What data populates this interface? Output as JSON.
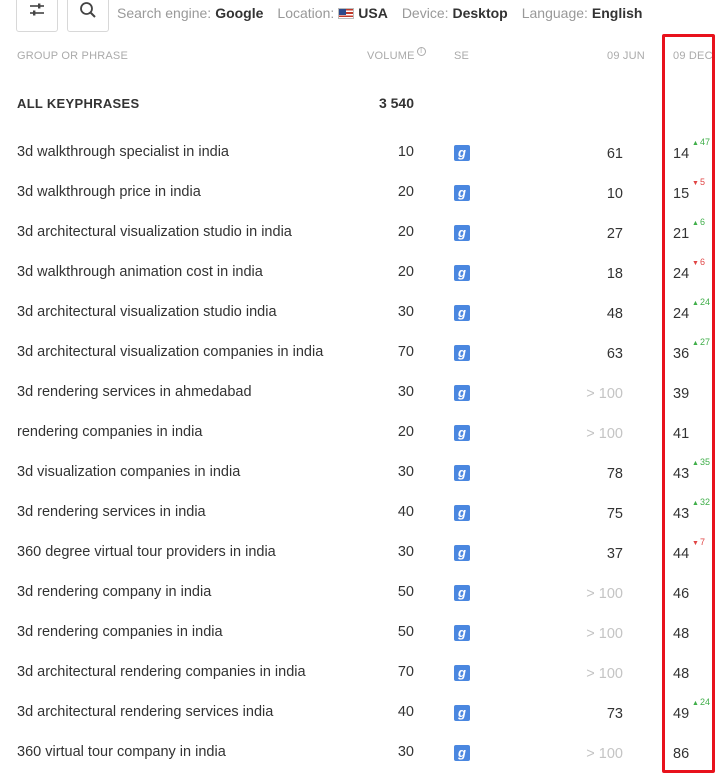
{
  "toolbar": {
    "filter_icon": "sliders-icon",
    "search_icon": "search-icon",
    "search_engine_label": "Search engine:",
    "search_engine_value": "Google",
    "location_label": "Location:",
    "location_flag": "us-flag-icon",
    "location_value": "USA",
    "device_label": "Device:",
    "device_value": "Desktop",
    "language_label": "Language:",
    "language_value": "English"
  },
  "columns": {
    "phrase": "GROUP OR PHRASE",
    "volume": "VOLUME",
    "volume_info": "i",
    "se": "SE",
    "date1": "09 JUN",
    "date2": "09 DEC"
  },
  "total": {
    "label": "ALL KEYPHRASES",
    "volume": "3 540"
  },
  "se_icon": "g",
  "rows": [
    {
      "phrase": "3d walkthrough specialist in india",
      "volume": "10",
      "jun": "61",
      "jun_muted": false,
      "dec": "14",
      "change": "47",
      "dir": "up"
    },
    {
      "phrase": "3d walkthrough price in india",
      "volume": "20",
      "jun": "10",
      "jun_muted": false,
      "dec": "15",
      "change": "5",
      "dir": "down"
    },
    {
      "phrase": "3d architectural visualization studio in india",
      "volume": "20",
      "jun": "27",
      "jun_muted": false,
      "dec": "21",
      "change": "6",
      "dir": "up"
    },
    {
      "phrase": "3d walkthrough animation cost in india",
      "volume": "20",
      "jun": "18",
      "jun_muted": false,
      "dec": "24",
      "change": "6",
      "dir": "down"
    },
    {
      "phrase": "3d architectural visualization studio india",
      "volume": "30",
      "jun": "48",
      "jun_muted": false,
      "dec": "24",
      "change": "24",
      "dir": "up"
    },
    {
      "phrase": "3d architectural visualization companies in india",
      "volume": "70",
      "jun": "63",
      "jun_muted": false,
      "dec": "36",
      "change": "27",
      "dir": "up"
    },
    {
      "phrase": "3d rendering services in ahmedabad",
      "volume": "30",
      "jun": "> 100",
      "jun_muted": true,
      "dec": "39",
      "change": "",
      "dir": ""
    },
    {
      "phrase": "rendering companies in india",
      "volume": "20",
      "jun": "> 100",
      "jun_muted": true,
      "dec": "41",
      "change": "",
      "dir": ""
    },
    {
      "phrase": "3d visualization companies in india",
      "volume": "30",
      "jun": "78",
      "jun_muted": false,
      "dec": "43",
      "change": "35",
      "dir": "up"
    },
    {
      "phrase": "3d rendering services in india",
      "volume": "40",
      "jun": "75",
      "jun_muted": false,
      "dec": "43",
      "change": "32",
      "dir": "up"
    },
    {
      "phrase": "360 degree virtual tour providers in india",
      "volume": "30",
      "jun": "37",
      "jun_muted": false,
      "dec": "44",
      "change": "7",
      "dir": "down"
    },
    {
      "phrase": "3d rendering company in india",
      "volume": "50",
      "jun": "> 100",
      "jun_muted": true,
      "dec": "46",
      "change": "",
      "dir": ""
    },
    {
      "phrase": "3d rendering companies in india",
      "volume": "50",
      "jun": "> 100",
      "jun_muted": true,
      "dec": "48",
      "change": "",
      "dir": ""
    },
    {
      "phrase": "3d architectural rendering companies in india",
      "volume": "70",
      "jun": "> 100",
      "jun_muted": true,
      "dec": "48",
      "change": "",
      "dir": ""
    },
    {
      "phrase": "3d architectural rendering services india",
      "volume": "40",
      "jun": "73",
      "jun_muted": false,
      "dec": "49",
      "change": "24",
      "dir": "up"
    },
    {
      "phrase": "360 virtual tour company in india",
      "volume": "30",
      "jun": "> 100",
      "jun_muted": true,
      "dec": "86",
      "change": "",
      "dir": ""
    }
  ],
  "colors": {
    "up": "#3fae49",
    "down": "#e04545",
    "highlight": "#e8121c",
    "se_badge": "#4a87e0"
  }
}
